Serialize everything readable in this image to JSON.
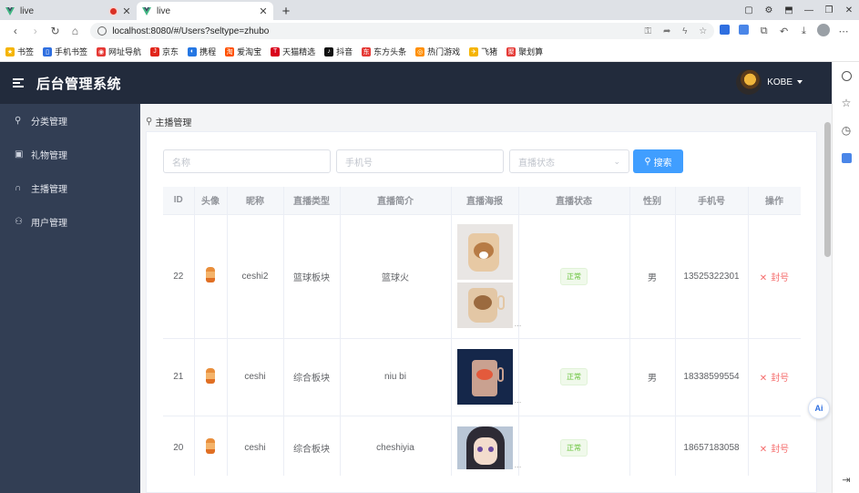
{
  "browser": {
    "tabs": [
      {
        "title": "live",
        "active": false
      },
      {
        "title": "live",
        "active": true
      }
    ],
    "url": "localhost:8080/#/Users?seltype=zhubo",
    "bookmarks": [
      {
        "label": "书签",
        "color": "#f5b400"
      },
      {
        "label": "手机书签",
        "color": "#2f6fe0"
      },
      {
        "label": "网址导航",
        "color": "#e53935"
      },
      {
        "label": "京东",
        "color": "#e1251b"
      },
      {
        "label": "携程",
        "color": "#2577e3"
      },
      {
        "label": "爱淘宝",
        "color": "#ff5000"
      },
      {
        "label": "天猫精选",
        "color": "#d9001b"
      },
      {
        "label": "抖音",
        "color": "#111111"
      },
      {
        "label": "东方头条",
        "color": "#e53935"
      },
      {
        "label": "热门游戏",
        "color": "#ff8f00"
      },
      {
        "label": "飞猪",
        "color": "#f5b400"
      },
      {
        "label": "聚划算",
        "color": "#e53935"
      }
    ]
  },
  "app": {
    "title": "后台管理系统",
    "user": "KOBE",
    "header_color": "#222b3c",
    "sidebar_color": "#323e54",
    "menu": [
      {
        "label": "分类管理",
        "icon": "paperclip-icon"
      },
      {
        "label": "礼物管理",
        "icon": "gift-icon"
      },
      {
        "label": "主播管理",
        "icon": "headset-icon"
      },
      {
        "label": "用户管理",
        "icon": "user-icon"
      }
    ],
    "breadcrumb": "主播管理",
    "search": {
      "name_placeholder": "名称",
      "phone_placeholder": "手机号",
      "status_placeholder": "直播状态",
      "button": "搜索",
      "button_color": "#409eff"
    },
    "table": {
      "headers": [
        "ID",
        "头像",
        "昵称",
        "直播类型",
        "直播简介",
        "直播海报",
        "直播状态",
        "性别",
        "手机号",
        "操作"
      ],
      "rows": [
        {
          "id": "22",
          "nick": "ceshi2",
          "type": "篮球板块",
          "intro": "篮球火",
          "status": "正常",
          "gender": "男",
          "phone": "13525322301",
          "action": "封号"
        },
        {
          "id": "21",
          "nick": "ceshi",
          "type": "综合板块",
          "intro": "niu bi",
          "status": "正常",
          "gender": "男",
          "phone": "18338599554",
          "action": "封号"
        },
        {
          "id": "20",
          "nick": "ceshi",
          "type": "综合板块",
          "intro": "cheshiyia",
          "status": "正常",
          "gender": "",
          "phone": "18657183058",
          "action": "封号"
        }
      ]
    }
  }
}
